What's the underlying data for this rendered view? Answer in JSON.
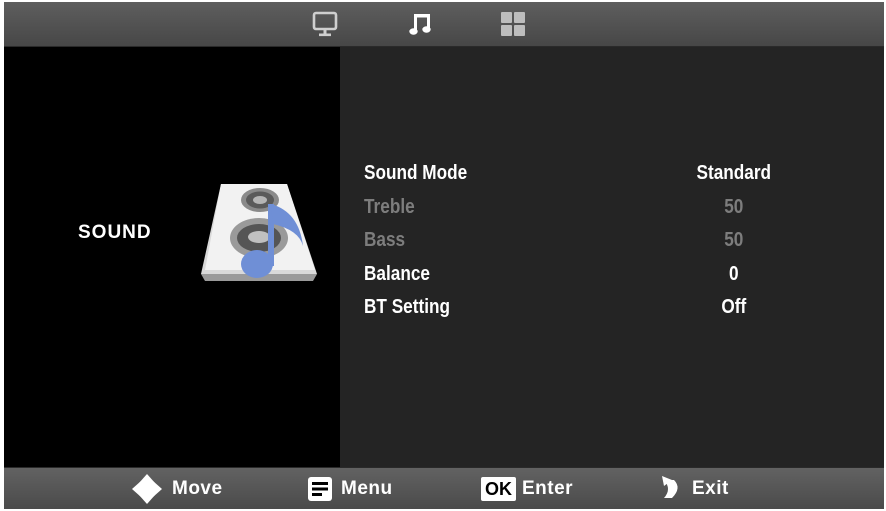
{
  "tabs": [
    {
      "icon": "monitor-icon",
      "active": false
    },
    {
      "icon": "music-note-icon",
      "active": true
    },
    {
      "icon": "apps-grid-icon",
      "active": false
    }
  ],
  "left_panel": {
    "title": "SOUND",
    "icon": "speaker-music-icon"
  },
  "menu": {
    "items": [
      {
        "label": "Sound Mode",
        "value": "Standard",
        "enabled": true
      },
      {
        "label": "Treble",
        "value": "50",
        "enabled": false
      },
      {
        "label": "Bass",
        "value": "50",
        "enabled": false
      },
      {
        "label": "Balance",
        "value": "0",
        "enabled": true
      },
      {
        "label": "BT Setting",
        "value": "Off",
        "enabled": true
      }
    ]
  },
  "footer": {
    "move_label": "Move",
    "menu_label": "Menu",
    "ok_badge": "OK",
    "enter_label": "Enter",
    "exit_label": "Exit"
  },
  "colors": {
    "text_enabled": "#ffffff",
    "text_disabled": "#7d7d7d",
    "panel_bg": "#242424",
    "bar_bg": "#555555",
    "note_blue": "#6f8fd6"
  }
}
